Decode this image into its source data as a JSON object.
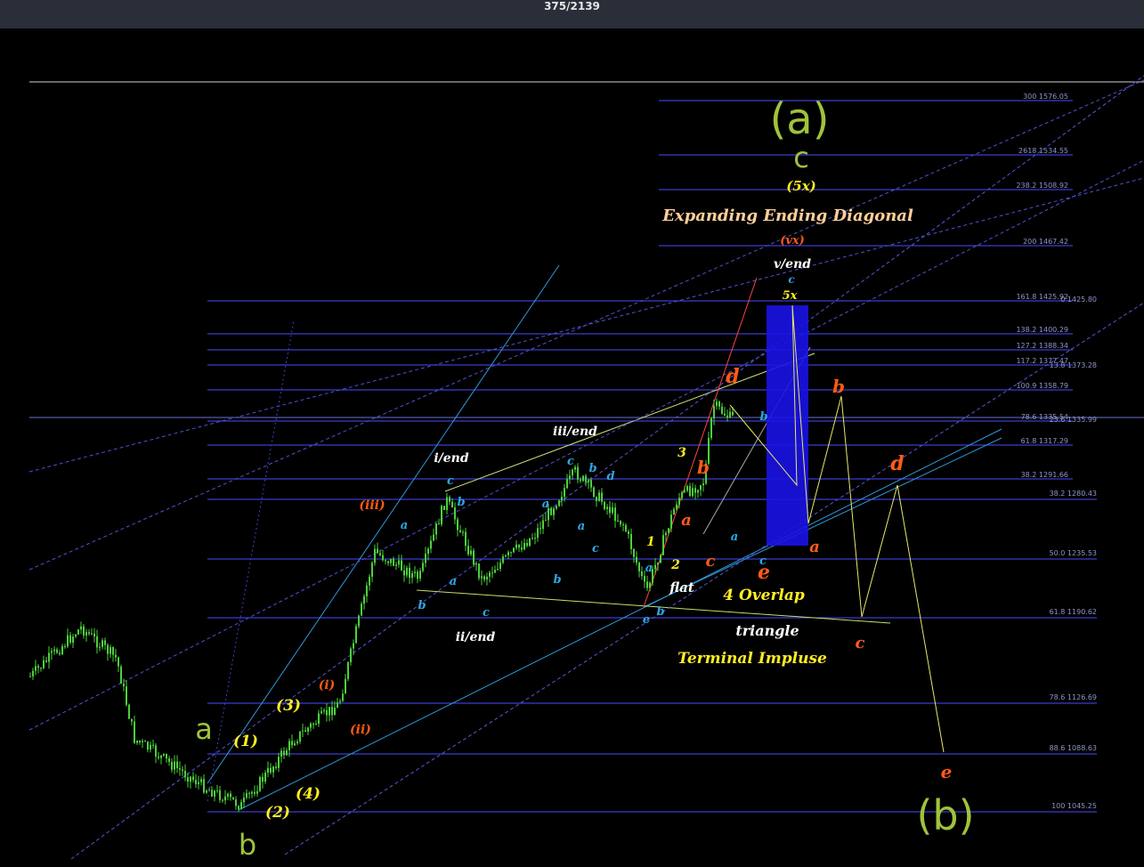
{
  "app": {
    "counter": "375/2139"
  },
  "colors": {
    "background": "#000000",
    "topbar": "#2a2e39",
    "candle": "#4cd13a",
    "fib_line": "#4a4cff",
    "channel": "#2f96d8",
    "yellow_label": "#ffee22",
    "orange_label": "#ff5b16",
    "green_label": "#9fc33b",
    "cyan_label": "#2ea8e6",
    "blue_box": "#1a12e6",
    "path_line": "#e8e86a"
  },
  "chart_data": {
    "type": "annotated_price_chart",
    "fib_levels_upper": [
      {
        "ratio": "300",
        "price": "1576.05"
      },
      {
        "ratio": "2618",
        "price": "1534.55"
      },
      {
        "ratio": "238.2",
        "price": "1508.92"
      },
      {
        "ratio": "200",
        "price": "1467.42"
      },
      {
        "ratio": "161.8",
        "price": "1425.92"
      },
      {
        "ratio": "138.2",
        "price": "1400.29"
      },
      {
        "ratio": "127.2",
        "price": "1388.34"
      },
      {
        "ratio": "117.2",
        "price": "1377.47"
      },
      {
        "ratio": "100.9",
        "price": "1358.79"
      },
      {
        "ratio": "78.6",
        "price": "1335.54"
      },
      {
        "ratio": "61.8",
        "price": "1317.29"
      },
      {
        "ratio": "38.2",
        "price": "1291.66"
      }
    ],
    "fib_levels_lower": [
      {
        "ratio": "0",
        "price": "1425.80"
      },
      {
        "ratio": "13.8",
        "price": "1373.28"
      },
      {
        "ratio": "23.6",
        "price": "1335.99"
      },
      {
        "ratio": "38.2",
        "price": "1280.43"
      },
      {
        "ratio": "50.0",
        "price": "1235.53"
      },
      {
        "ratio": "61.8",
        "price": "1190.62"
      },
      {
        "ratio": "78.6",
        "price": "1126.69"
      },
      {
        "ratio": "88.6",
        "price": "1088.63"
      },
      {
        "ratio": "100",
        "price": "1045.25"
      }
    ],
    "annotations": {
      "major": [
        "(a)",
        "c",
        "(b)",
        "a",
        "b"
      ],
      "titles": [
        "Expanding Ending Diagonal",
        "(5x)",
        "(vx)",
        "v/end",
        "5x",
        "iii/end",
        "i/end",
        "ii/end",
        "(iii)",
        "(i)",
        "(ii)",
        "(1)",
        "(2)",
        "(3)",
        "(4)",
        "flat",
        "4 Overlap",
        "triangle",
        "Terminal Impluse"
      ],
      "projection": [
        "a",
        "b",
        "c",
        "d",
        "e"
      ]
    }
  }
}
